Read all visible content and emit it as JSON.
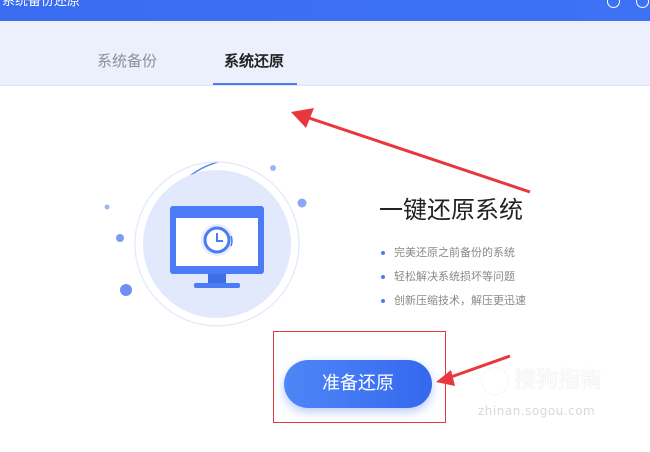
{
  "window": {
    "title": "系统备份还原"
  },
  "tabs": [
    {
      "label": "系统备份",
      "active": false
    },
    {
      "label": "系统还原",
      "active": true
    }
  ],
  "main": {
    "headline": "一键还原系统",
    "features": [
      "完美还原之前备份的系统",
      "轻松解决系统损坏等问题",
      "创新压缩技术，解压更迅速"
    ],
    "primary_button": "准备还原"
  },
  "watermark": {
    "brand": "搜狗指南",
    "url": "zhinan.sogou.com"
  },
  "icons": {
    "illustration": "computer-clock-restore-icon",
    "titlebar_right": [
      "feedback-icon",
      "settings-icon"
    ]
  },
  "colors": {
    "accent": "#3d72f4",
    "tab_bar_bg": "#ecf0fc",
    "annotation_red": "#e8383d"
  }
}
